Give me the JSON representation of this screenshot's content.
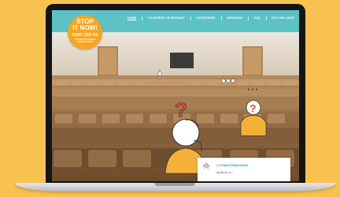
{
  "nav": {
    "items": [
      {
        "label": "HOME",
        "active": true
      },
      {
        "label": "COUNTRIES OF MIGRANT",
        "active": false
      },
      {
        "label": "CATEGORIES",
        "active": false
      },
      {
        "label": "WEBINARS",
        "active": false
      },
      {
        "label": "FAQ",
        "active": false
      },
      {
        "label": "HOTLINE LINKS",
        "active": false
      }
    ]
  },
  "logo": {
    "line1": "STOP",
    "line2": "IT NOW!",
    "phone": "0800 200 50",
    "tagline": "SUPPORT FOR PEOPLE WORRIED ABOUT"
  },
  "card": {
    "title": "LOTSBASTRÄNGANDE",
    "subtitle": "Spräk för er ›",
    "icon": "people-group-icon"
  },
  "colors": {
    "background": "#f7c24f",
    "nav": "#5cc2c6",
    "logo": "#f6a623",
    "question_mark": "#e0483a",
    "shirt": "#f4b13a"
  }
}
